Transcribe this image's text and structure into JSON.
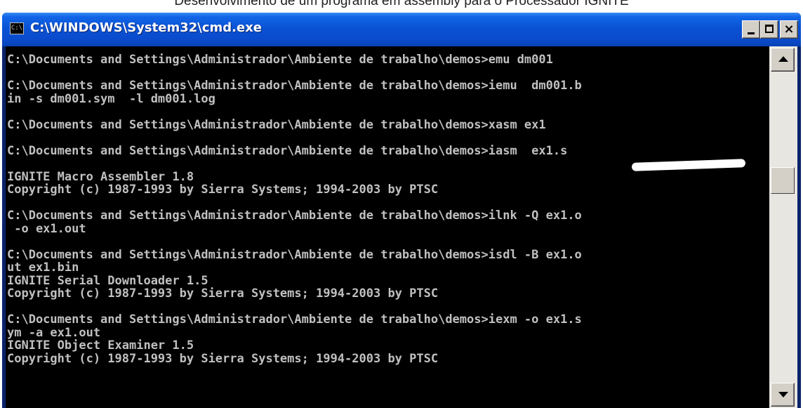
{
  "background_text": "Desenvolvimento de um programa em assembly para o Processador IGNITE",
  "window": {
    "title": "C:\\WINDOWS\\System32\\cmd.exe",
    "icon_label": "C:\\",
    "icon": "console-icon",
    "buttons": {
      "minimize": "minimize-icon",
      "maximize": "maximize-icon",
      "close": "close-icon",
      "close_label": "×"
    }
  },
  "console": {
    "lines": [
      "C:\\Documents and Settings\\Administrador\\Ambiente de trabalho\\demos>emu dm001",
      "",
      "C:\\Documents and Settings\\Administrador\\Ambiente de trabalho\\demos>iemu  dm001.b",
      "in -s dm001.sym  -l dm001.log",
      "",
      "C:\\Documents and Settings\\Administrador\\Ambiente de trabalho\\demos>xasm ex1",
      "",
      "C:\\Documents and Settings\\Administrador\\Ambiente de trabalho\\demos>iasm  ex1.s",
      "",
      "IGNITE Macro Assembler 1.8",
      "Copyright (c) 1987-1993 by Sierra Systems; 1994-2003 by PTSC",
      "",
      "C:\\Documents and Settings\\Administrador\\Ambiente de trabalho\\demos>ilnk -Q ex1.o",
      " -o ex1.out",
      "",
      "C:\\Documents and Settings\\Administrador\\Ambiente de trabalho\\demos>isdl -B ex1.o",
      "ut ex1.bin",
      "IGNITE Serial Downloader 1.5",
      "Copyright (c) 1987-1993 by Sierra Systems; 1994-2003 by PTSC",
      "",
      "C:\\Documents and Settings\\Administrador\\Ambiente de trabalho\\demos>iexm -o ex1.s",
      "ym -a ex1.out",
      "IGNITE Object Examiner 1.5",
      "Copyright (c) 1987-1993 by Sierra Systems; 1994-2003 by PTSC"
    ]
  },
  "scrollbar": {
    "up": "arrow-up-icon",
    "down": "arrow-down-icon"
  }
}
